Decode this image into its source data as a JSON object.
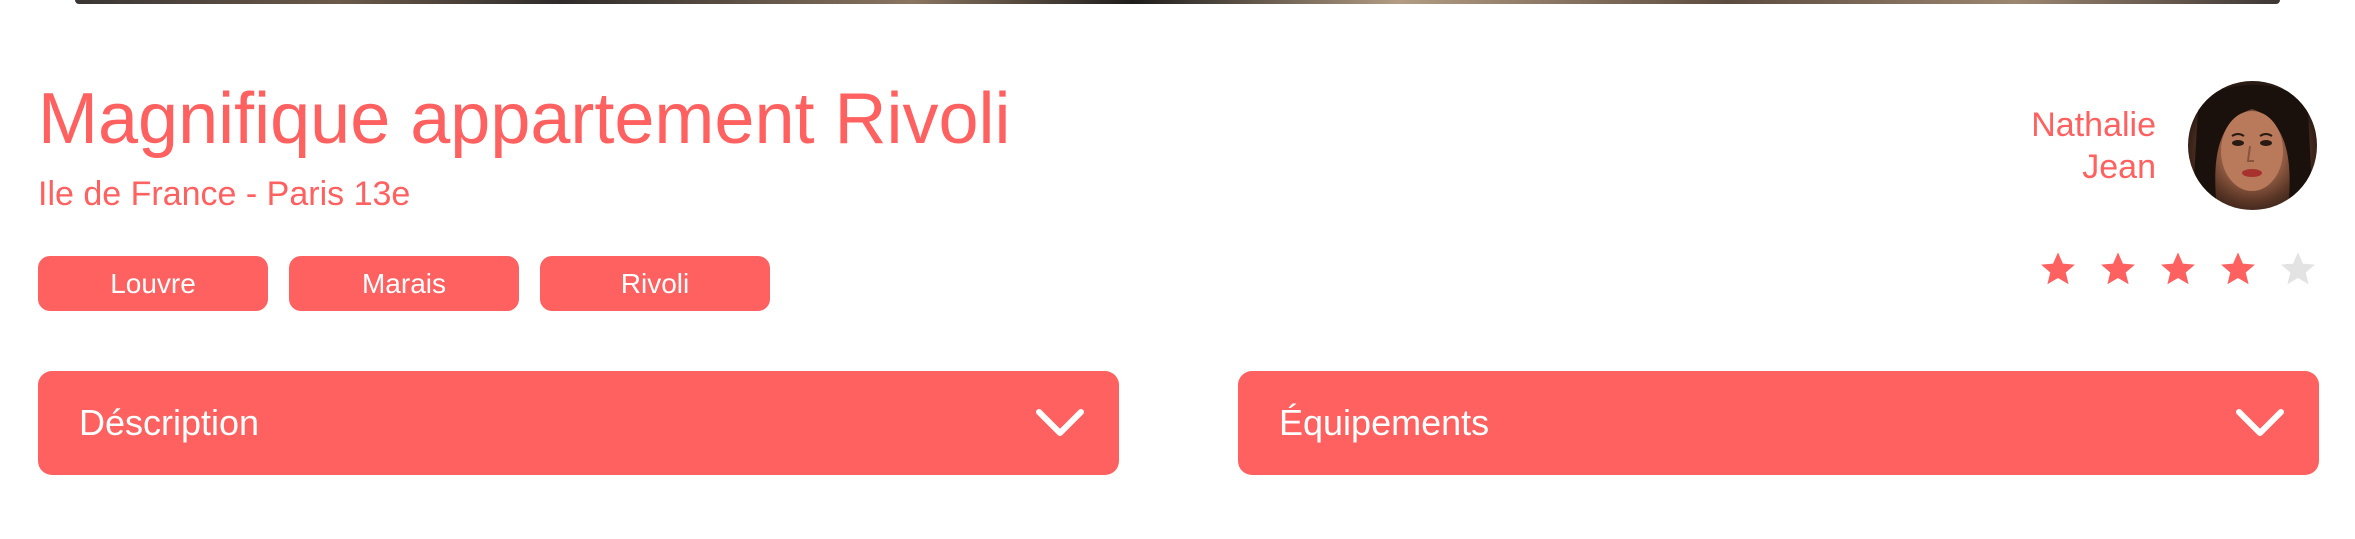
{
  "listing": {
    "title": "Magnifique appartement Rivoli",
    "location": "Ile de France - Paris 13e",
    "tags": [
      "Louvre",
      "Marais",
      "Rivoli"
    ]
  },
  "host": {
    "first_name": "Nathalie",
    "last_name": "Jean"
  },
  "rating": {
    "value": 4,
    "max": 5
  },
  "sections": {
    "description_label": "Déscription",
    "equipments_label": "Équipements"
  },
  "colors": {
    "accent": "#FF6060",
    "star_empty": "#E3E3E3",
    "text_on_accent": "#FFFFFF"
  },
  "icons": {
    "star": "star-icon",
    "chevron": "chevron-down-icon"
  }
}
